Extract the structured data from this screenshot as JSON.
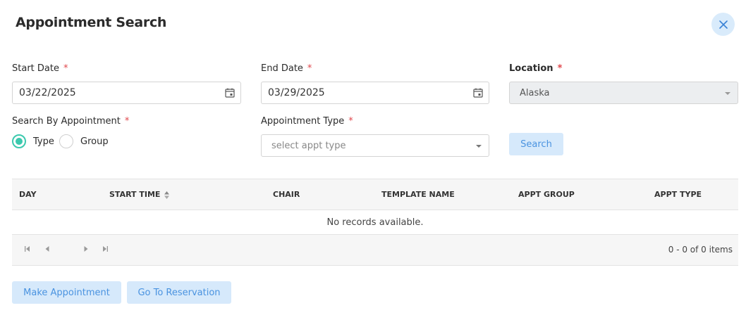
{
  "title": "Appointment Search",
  "fields": {
    "start_date": {
      "label": "Start Date",
      "required": "*",
      "value": "03/22/2025"
    },
    "end_date": {
      "label": "End Date",
      "required": "*",
      "value": "03/29/2025"
    },
    "location": {
      "label": "Location",
      "required": "*",
      "value": "Alaska"
    },
    "search_by": {
      "label": "Search By Appointment",
      "required": "*",
      "options": [
        "Type",
        "Group"
      ],
      "selected": "Type"
    },
    "appt_type": {
      "label": "Appointment Type",
      "required": "*",
      "placeholder": "select appt type"
    }
  },
  "search_button": "Search",
  "table": {
    "columns": [
      "DAY",
      "START TIME",
      "CHAIR",
      "TEMPLATE NAME",
      "APPT GROUP",
      "APPT TYPE"
    ],
    "empty_message": "No records available.",
    "pager_info": "0 - 0 of 0 items"
  },
  "actions": {
    "make_appointment": "Make Appointment",
    "go_to_reservation": "Go To Reservation"
  },
  "colors": {
    "accent": "#4a93e0",
    "radio_selected": "#3cc9ae",
    "required": "#e0474c"
  }
}
